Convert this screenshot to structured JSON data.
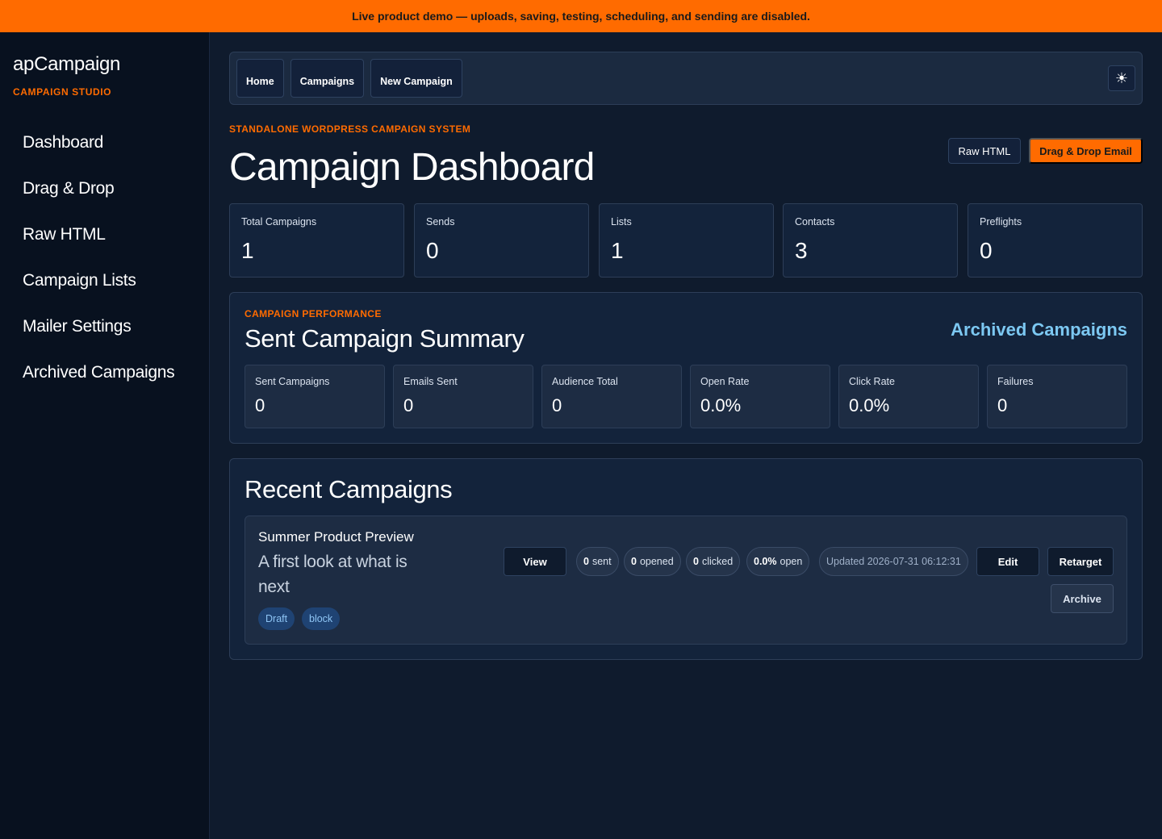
{
  "banner": {
    "text": "Live product demo — uploads, saving, testing, scheduling, and sending are disabled."
  },
  "sidebar": {
    "brand": "apCampaign",
    "brand_sub": "CAMPAIGN STUDIO",
    "items": [
      {
        "label": "Dashboard"
      },
      {
        "label": "Drag & Drop"
      },
      {
        "label": "Raw HTML"
      },
      {
        "label": "Campaign Lists"
      },
      {
        "label": "Mailer Settings"
      },
      {
        "label": "Archived Campaigns"
      }
    ]
  },
  "topnav": {
    "buttons": [
      {
        "label": "Home"
      },
      {
        "label": "Campaigns"
      },
      {
        "label": "New Campaign"
      }
    ],
    "theme_icon": "sun-icon",
    "theme_glyph": "☀"
  },
  "header": {
    "eyebrow": "STANDALONE WORDPRESS CAMPAIGN SYSTEM",
    "title": "Campaign Dashboard",
    "raw_html_label": "Raw HTML",
    "dnd_label": "Drag & Drop Email"
  },
  "stats": [
    {
      "label": "Total Campaigns",
      "value": "1"
    },
    {
      "label": "Sends",
      "value": "0"
    },
    {
      "label": "Lists",
      "value": "1"
    },
    {
      "label": "Contacts",
      "value": "3"
    },
    {
      "label": "Preflights",
      "value": "0"
    }
  ],
  "performance": {
    "eyebrow": "CAMPAIGN PERFORMANCE",
    "title": "Sent Campaign Summary",
    "archived_link": "Archived Campaigns",
    "metrics": [
      {
        "label": "Sent Campaigns",
        "value": "0"
      },
      {
        "label": "Emails Sent",
        "value": "0"
      },
      {
        "label": "Audience Total",
        "value": "0"
      },
      {
        "label": "Open Rate",
        "value": "0.0%"
      },
      {
        "label": "Click Rate",
        "value": "0.0%"
      },
      {
        "label": "Failures",
        "value": "0"
      }
    ]
  },
  "recent": {
    "title": "Recent Campaigns",
    "campaign": {
      "name": "Summer Product Preview",
      "subject": "A first look at what is next",
      "tags": [
        "Draft",
        "block"
      ],
      "view_label": "View",
      "sent": {
        "num": "0",
        "label": "sent"
      },
      "opened": {
        "num": "0",
        "label": "opened"
      },
      "clicked": {
        "num": "0",
        "label": "clicked"
      },
      "open_rate": {
        "num": "0.0%",
        "label": "open"
      },
      "updated": "Updated 2026-07-31 06:12:31",
      "edit_label": "Edit",
      "retarget_label": "Retarget",
      "archive_label": "Archive"
    }
  },
  "colors": {
    "accent": "#ff6b00",
    "link": "#7cc8f2",
    "background": "#0f1b2d",
    "sidebar": "#08111f",
    "card": "#13233b"
  }
}
